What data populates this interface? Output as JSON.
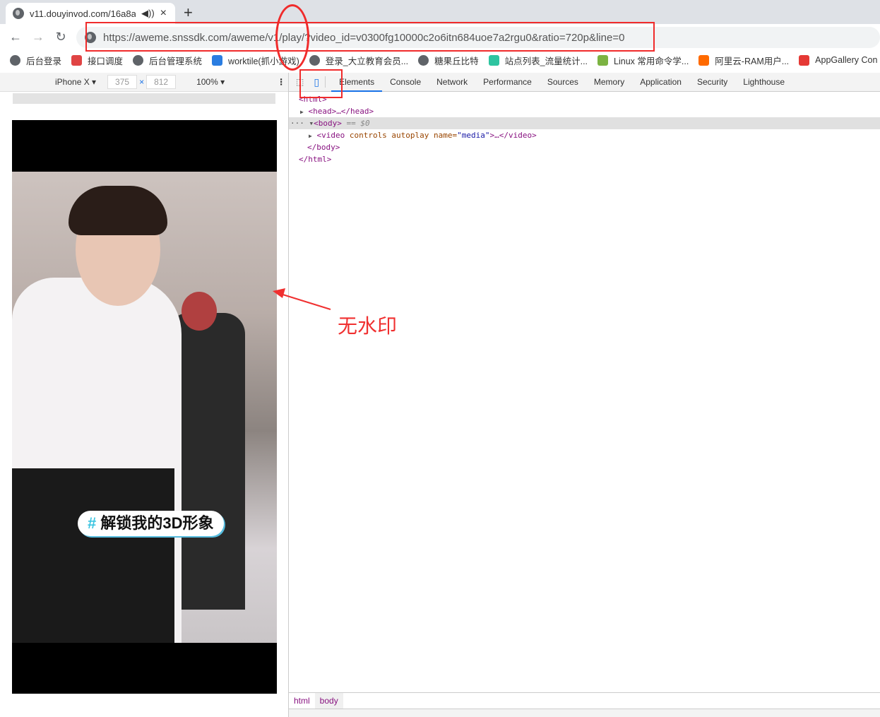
{
  "tab": {
    "title": "v11.douyinvod.com/16a8a",
    "audio_icon": "speaker-icon",
    "close": "×",
    "new_tab": "+"
  },
  "address": {
    "url": "https://aweme.snssdk.com/aweme/v1/play/?video_id=v0300fg10000c2o6itn684uoe7a2rgu0&ratio=720p&line=0"
  },
  "bookmarks": [
    {
      "label": "后台登录",
      "color": "#5f6368"
    },
    {
      "label": "接口调度",
      "color": "#e04444"
    },
    {
      "label": "后台管理系统",
      "color": "#5f6368"
    },
    {
      "label": "worktile(抓小游戏)",
      "color": "#2a7de1"
    },
    {
      "label": "登录_大立教育会员...",
      "color": "#5f6368"
    },
    {
      "label": "糖果丘比特",
      "color": "#5f6368"
    },
    {
      "label": "站点列表_流量统计...",
      "color": "#2ec4a0"
    },
    {
      "label": "Linux 常用命令学...",
      "color": "#7cb342"
    },
    {
      "label": "阿里云-RAM用户...",
      "color": "#ff6a00"
    },
    {
      "label": "AppGallery Con",
      "color": "#e53935"
    }
  ],
  "device": {
    "name": "iPhone X",
    "width": "375",
    "height": "812",
    "zoom": "100%",
    "x": "×"
  },
  "video": {
    "caption_hash": "#",
    "caption": "解锁我的3D形象"
  },
  "devtools": {
    "tabs": [
      "Elements",
      "Console",
      "Network",
      "Performance",
      "Sources",
      "Memory",
      "Application",
      "Security",
      "Lighthouse"
    ],
    "active_tab": "Elements",
    "dom": {
      "html_open": "<html>",
      "head": "<head>…</head>",
      "body_open": "<body>",
      "body_marker": "== $0",
      "video_tag": "<video",
      "video_attrs": "controls autoplay",
      "video_name_attr": "name=",
      "video_name_val": "\"media\"",
      "video_close": ">…</video>",
      "body_close": "</body>",
      "html_close": "</html>"
    },
    "breadcrumbs": [
      "html",
      "body"
    ]
  },
  "annotation": {
    "text": "无水印",
    "color": "#f03030"
  }
}
